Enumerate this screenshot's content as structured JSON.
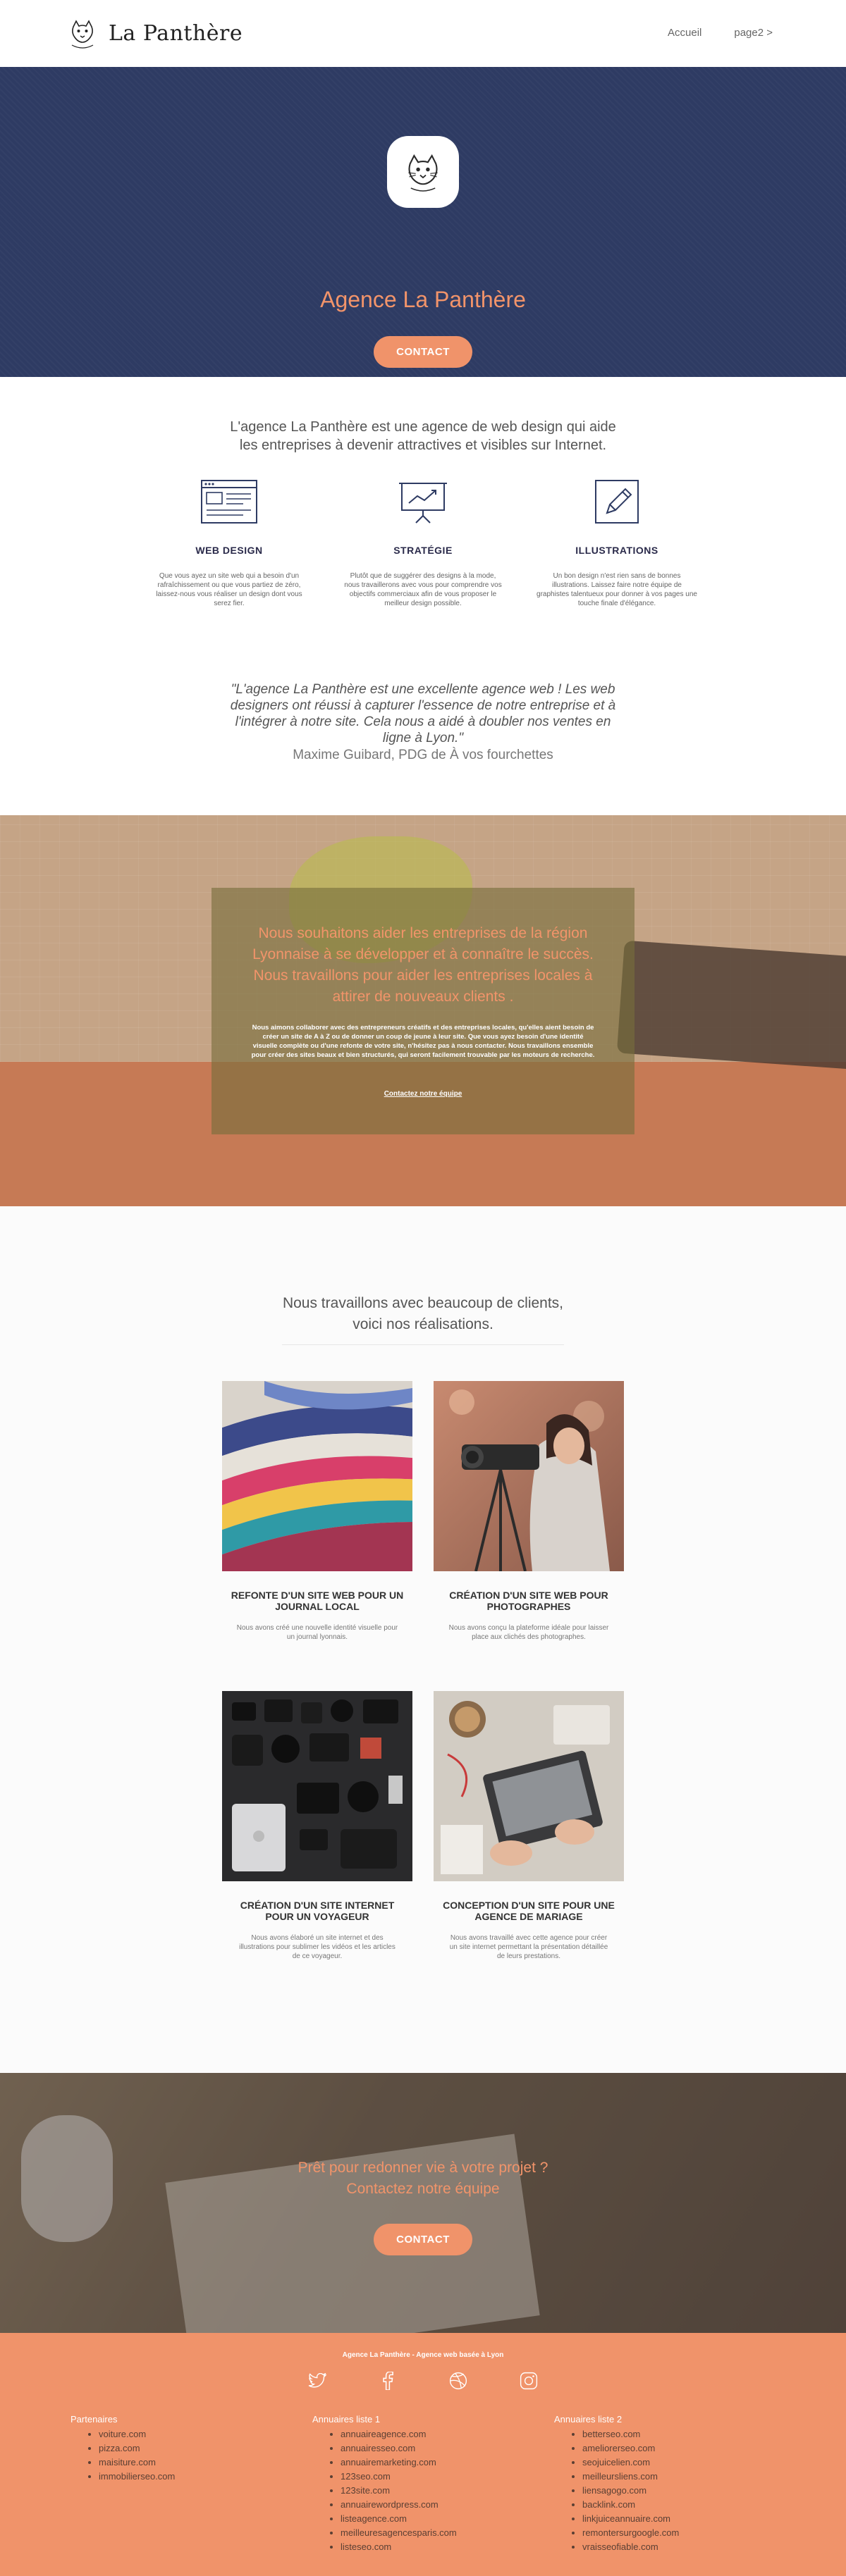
{
  "header": {
    "brand": "La Panthère",
    "nav": [
      "Accueil",
      "page2 >"
    ]
  },
  "hero": {
    "title": "Agence La Panthère",
    "button": "CONTACT"
  },
  "intro": {
    "text_line1": "L'agence La Panthère est une agence de web design qui aide",
    "text_line2": "les entreprises à devenir attractives et visibles sur Internet.",
    "services": [
      {
        "icon": "browser-window-icon",
        "title": "WEB DESIGN",
        "text": "Que vous ayez un site web qui a besoin d'un rafraîchissement ou que vous partiez de zéro, laissez-nous vous réaliser un design dont vous serez fier."
      },
      {
        "icon": "presentation-chart-icon",
        "title": "STRATÉGIE",
        "text": "Plutôt que de suggérer des designs à la mode, nous travaillerons avec vous pour comprendre vos objectifs commerciaux afin de vous proposer le meilleur design possible."
      },
      {
        "icon": "pencil-icon",
        "title": "ILLUSTRATIONS",
        "text": "Un bon design n'est rien sans de bonnes illustrations. Laissez faire notre équipe de graphistes talentueux pour donner à vos pages une touche finale d'élégance."
      }
    ],
    "quote": "\"L'agence La Panthère est une excellente agence web ! Les web designers ont réussi à capturer l'essence de notre entreprise et à l'intégrer à notre site. Cela nous a aidé à doubler nos ventes en ligne à Lyon.\"",
    "quote_author": "Maxime Guibard, PDG de À vos fourchettes"
  },
  "banner": {
    "title": "Nous souhaitons aider les entreprises de la région Lyonnaise à se développer et à connaître le succès. Nous travaillons pour aider les entreprises locales à attirer de nouveaux clients .",
    "body": "Nous aimons collaborer avec des entrepreneurs créatifs et des entreprises locales, qu'elles aient besoin de créer un site de A à Z ou de donner un coup de jeune à leur site. Que vous ayez besoin d'une identité visuelle complète ou d'une refonte de votre site, n'hésitez pas à nous contacter. Nous travaillons ensemble pour créer des sites beaux et bien structurés, qui seront facilement trouvable par les moteurs de recherche.",
    "link": "Contactez notre équipe"
  },
  "works": {
    "title_line1": "Nous travaillons avec beaucoup de clients,",
    "title_line2": "voici nos réalisations.",
    "items": [
      {
        "title": "REFONTE D'UN SITE WEB POUR UN JOURNAL LOCAL",
        "text": "Nous avons créé une nouvelle identité visuelle pour un journal lyonnais."
      },
      {
        "title": "CRÉATION D'UN SITE WEB POUR PHOTOGRAPHES",
        "text": "Nous avons conçu la plateforme idéale pour laisser place aux clichés des photographes."
      },
      {
        "title": "CRÉATION D'UN SITE INTERNET POUR UN VOYAGEUR",
        "text": "Nous avons élaboré un site internet et des illustrations pour sublimer les vidéos et les articles de ce voyageur."
      },
      {
        "title": "CONCEPTION D'UN SITE POUR UNE AGENCE DE MARIAGE",
        "text": "Nous avons travaillé avec cette agence pour créer un site internet permettant la présentation détaillée de leurs prestations."
      }
    ]
  },
  "cta": {
    "line1": "Prêt pour redonner vie à votre projet ?",
    "line2": "Contactez notre équipe",
    "button": "CONTACT"
  },
  "footer": {
    "tagline": "Agence La Panthère - Agence web basée à Lyon",
    "socials": [
      "twitter-icon",
      "facebook-icon",
      "dribbble-icon",
      "instagram-icon"
    ],
    "columns": [
      {
        "title": "Partenaires",
        "links": [
          "voiture.com",
          "pizza.com",
          "maisiture.com",
          "immobilierseo.com"
        ]
      },
      {
        "title": "Annuaires liste 1",
        "links": [
          "annuaireagence.com",
          "annuairesseo.com",
          "annuairemarketing.com",
          "123seo.com",
          "123site.com",
          "annuairewordpress.com",
          "listeagence.com",
          "meilleuresagencesparis.com",
          "listeseo.com"
        ]
      },
      {
        "title": "Annuaires liste 2",
        "links": [
          "betterseo.com",
          "ameliorerseo.com",
          "seojuicelien.com",
          "meilleursliens.com",
          "liensagogo.com",
          "backlink.com",
          "linkjuiceannuaire.com",
          "remontersurgoogle.com",
          "vraisseofiable.com"
        ]
      }
    ]
  },
  "colors": {
    "navy": "#2e3b63",
    "accent": "#f0936a"
  }
}
